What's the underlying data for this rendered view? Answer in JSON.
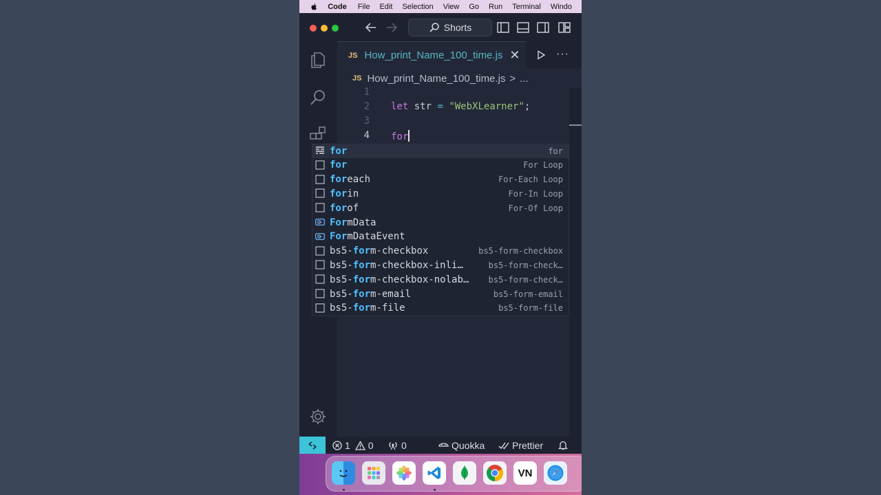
{
  "menubar": {
    "app": "Code",
    "items": [
      "File",
      "Edit",
      "Selection",
      "View",
      "Go",
      "Run",
      "Terminal",
      "Windo"
    ]
  },
  "titlebar": {
    "search_label": "Shorts"
  },
  "editor": {
    "tab": {
      "badge": "JS",
      "filename": "How_print_Name_100_time.js",
      "close": "✕"
    },
    "breadcrumb": {
      "badge": "JS",
      "file": "How_print_Name_100_time.js",
      "separator": ">",
      "more": "..."
    },
    "lines": [
      {
        "number": "1",
        "text": ""
      },
      {
        "number": "2",
        "kw": "let",
        "ident": " str ",
        "op": "=",
        "str": " \"WebXLearner\"",
        "tail": ";"
      },
      {
        "number": "3",
        "text": ""
      },
      {
        "number": "4",
        "text": "for"
      }
    ]
  },
  "suggestions": [
    {
      "match": "for",
      "rest": "",
      "detail": "for",
      "icon": "keyword-icon"
    },
    {
      "match": "for",
      "rest": "",
      "detail": "For Loop",
      "icon": "snippet-icon"
    },
    {
      "match": "for",
      "rest": "each",
      "detail": "For-Each Loop",
      "icon": "snippet-icon"
    },
    {
      "match": "for",
      "rest": "in",
      "detail": "For-In Loop",
      "icon": "snippet-icon"
    },
    {
      "match": "for",
      "rest": "of",
      "detail": "For-Of Loop",
      "icon": "snippet-icon"
    },
    {
      "match": "For",
      "rest": "mData",
      "detail": "",
      "icon": "variable-icon"
    },
    {
      "match": "For",
      "rest": "mDataEvent",
      "detail": "",
      "icon": "variable-icon"
    },
    {
      "prefix": "bs5-",
      "match": "for",
      "rest": "m-checkbox",
      "detail": "bs5-form-checkbox",
      "icon": "snippet-icon"
    },
    {
      "prefix": "bs5-",
      "match": "for",
      "rest": "m-checkbox-inli…",
      "detail": "bs5-form-check…",
      "icon": "snippet-icon"
    },
    {
      "prefix": "bs5-",
      "match": "for",
      "rest": "m-checkbox-nolab…",
      "detail": "bs5-form-check…",
      "icon": "snippet-icon"
    },
    {
      "prefix": "bs5-",
      "match": "for",
      "rest": "m-email",
      "detail": "bs5-form-email",
      "icon": "snippet-icon"
    },
    {
      "prefix": "bs5-",
      "match": "for",
      "rest": "m-file",
      "detail": "bs5-form-file",
      "icon": "snippet-icon"
    }
  ],
  "statusbar": {
    "errors": "1",
    "warnings": "0",
    "ports": "0",
    "quokka": "Quokka",
    "prettier": "Prettier"
  },
  "dock": {
    "apps": [
      "finder-icon",
      "launchpad-icon",
      "photos-icon",
      "vscode-icon",
      "mongodb-icon",
      "chrome-icon",
      "vn-icon",
      "safari-icon"
    ],
    "vn_label": "VN"
  },
  "colors": {
    "keyword": "#c678dd",
    "string": "#98c379",
    "match_highlight": "#4fc1ff",
    "tab_name": "#56b6c2",
    "remote_indicator": "#3cc3d8"
  }
}
